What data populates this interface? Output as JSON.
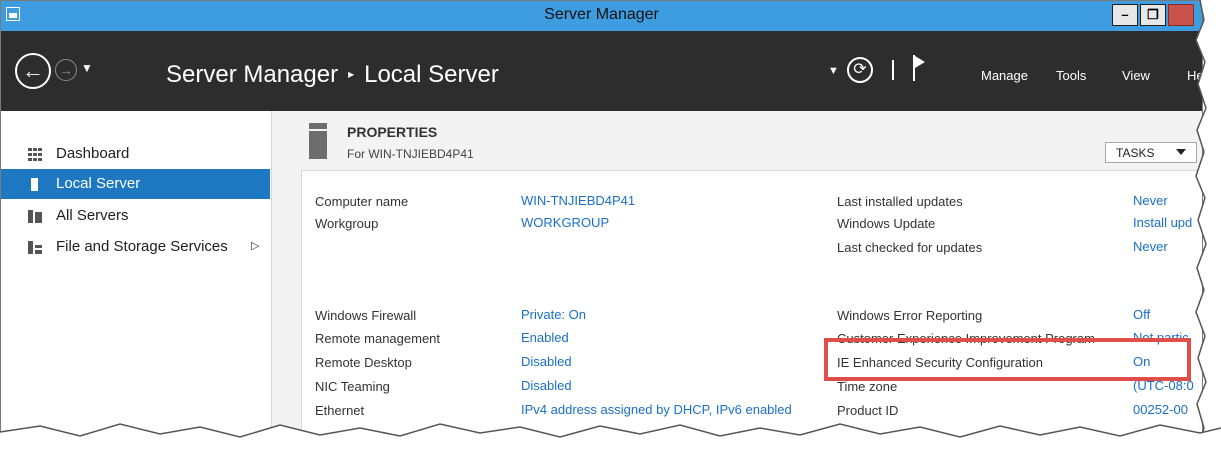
{
  "window": {
    "title": "Server Manager",
    "controls": {
      "minimize": "–",
      "restore": "❐",
      "close": ""
    }
  },
  "header": {
    "breadcrumb_root": "Server Manager",
    "breadcrumb_separator": "▸",
    "breadcrumb_current": "Local Server",
    "menu": [
      "Manage",
      "Tools",
      "View",
      "He"
    ]
  },
  "sidebar": {
    "items": [
      {
        "label": "Dashboard",
        "icon": "dashboard-icon"
      },
      {
        "label": "Local Server",
        "icon": "server-icon",
        "active": true
      },
      {
        "label": "All Servers",
        "icon": "servers-icon"
      },
      {
        "label": "File and Storage Services",
        "icon": "storage-icon",
        "expand": "▷"
      }
    ]
  },
  "properties": {
    "title": "PROPERTIES",
    "subtitle": "For WIN-TNJIEBD4P41",
    "tasks_label": "TASKS",
    "left": [
      {
        "label": "Computer name",
        "value": "WIN-TNJIEBD4P41"
      },
      {
        "label": "Workgroup",
        "value": "WORKGROUP"
      },
      {
        "label": "Windows Firewall",
        "value": "Private: On"
      },
      {
        "label": "Remote management",
        "value": "Enabled"
      },
      {
        "label": "Remote Desktop",
        "value": "Disabled"
      },
      {
        "label": "NIC Teaming",
        "value": "Disabled"
      },
      {
        "label": "Ethernet",
        "value": "IPv4 address assigned by DHCP, IPv6 enabled"
      }
    ],
    "right": [
      {
        "label": "Last installed updates",
        "value": "Never"
      },
      {
        "label": "Windows Update",
        "value": "Install upd"
      },
      {
        "label": "Last checked for updates",
        "value": "Never"
      },
      {
        "label": "Windows Error Reporting",
        "value": "Off"
      },
      {
        "label": "Customer Experience Improvement Program",
        "value": "Not partic"
      },
      {
        "label": "IE Enhanced Security Configuration",
        "value": "On"
      },
      {
        "label": "Time zone",
        "value": "(UTC-08:0"
      },
      {
        "label": "Product ID",
        "value": "00252-00"
      }
    ]
  },
  "colors": {
    "titlebar": "#3d9de0",
    "header": "#2d2d2d",
    "active_nav": "#1d78c1",
    "link": "#1a6fc9",
    "highlight": "#e04e4a"
  }
}
